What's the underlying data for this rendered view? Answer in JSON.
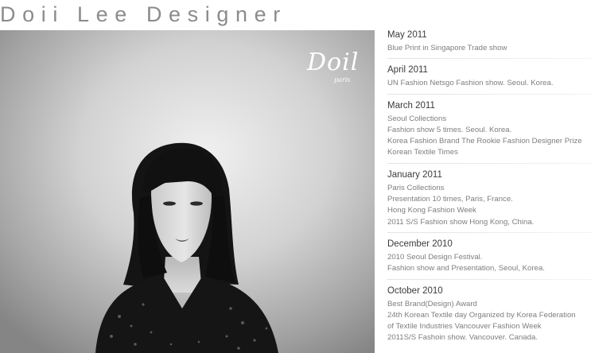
{
  "header": {
    "title": "Doii Lee Designer"
  },
  "photo": {
    "logo_text": "Doil",
    "logo_sub": "paris"
  },
  "timeline": [
    {
      "date": "May 2011",
      "lines": [
        "Blue Print in Singapore Trade show"
      ]
    },
    {
      "date": "April 2011",
      "lines": [
        "UN Fashion Netsgo Fashion show. Seoul. Korea."
      ]
    },
    {
      "date": "March 2011",
      "lines": [
        "Seoul Collections",
        "Fashion show 5 times. Seoul. Korea.",
        "Korea Fashion Brand The Rookie Fashion Designer Prize",
        "Korean Textile Times"
      ]
    },
    {
      "date": "January 2011",
      "lines": [
        "Paris Collections",
        "Presentation 10 times, Paris, France.",
        "Hong Kong Fashion Week",
        "2011 S/S Fashion show Hong Kong, China."
      ]
    },
    {
      "date": "December 2010",
      "lines": [
        "2010 Seoul Design Festival.",
        "Fashion show and Presentation, Seoul, Korea."
      ]
    },
    {
      "date": "October 2010",
      "lines": [
        "Best Brand(Design) Award",
        "24th Korean Textile day Organized by Korea Federation",
        "of Textile Industries Vancouver Fashion Week",
        "2011S/S Fashoin show. Vancouver. Canada."
      ]
    }
  ]
}
